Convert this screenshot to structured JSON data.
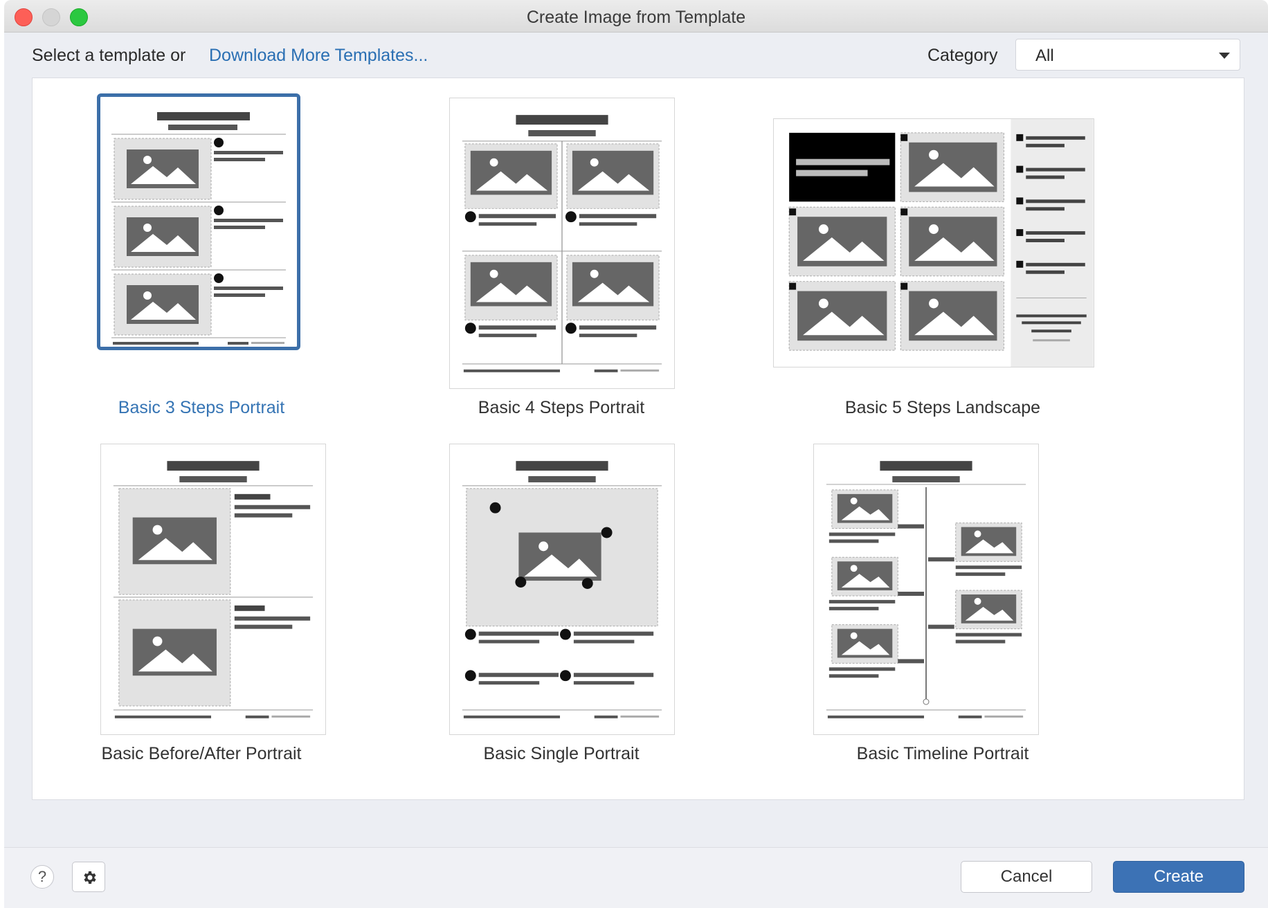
{
  "window": {
    "title": "Create Image from Template"
  },
  "toolbar": {
    "prompt": "Select a template or",
    "download_link": "Download More Templates...",
    "category_label": "Category",
    "category_value": "All"
  },
  "templates": [
    {
      "name": "Basic 3 Steps Portrait",
      "selected": true
    },
    {
      "name": "Basic 4 Steps Portrait",
      "selected": false
    },
    {
      "name": "Basic 5 Steps Landscape",
      "selected": false
    },
    {
      "name": "Basic Before/After Portrait",
      "selected": false
    },
    {
      "name": "Basic Single Portrait",
      "selected": false
    },
    {
      "name": "Basic Timeline Portrait",
      "selected": false
    }
  ],
  "footer": {
    "help_label": "?",
    "cancel_label": "Cancel",
    "create_label": "Create"
  },
  "colors": {
    "accent": "#3c72b5",
    "link": "#2a6fb3",
    "selection": "#3c6fa9"
  }
}
